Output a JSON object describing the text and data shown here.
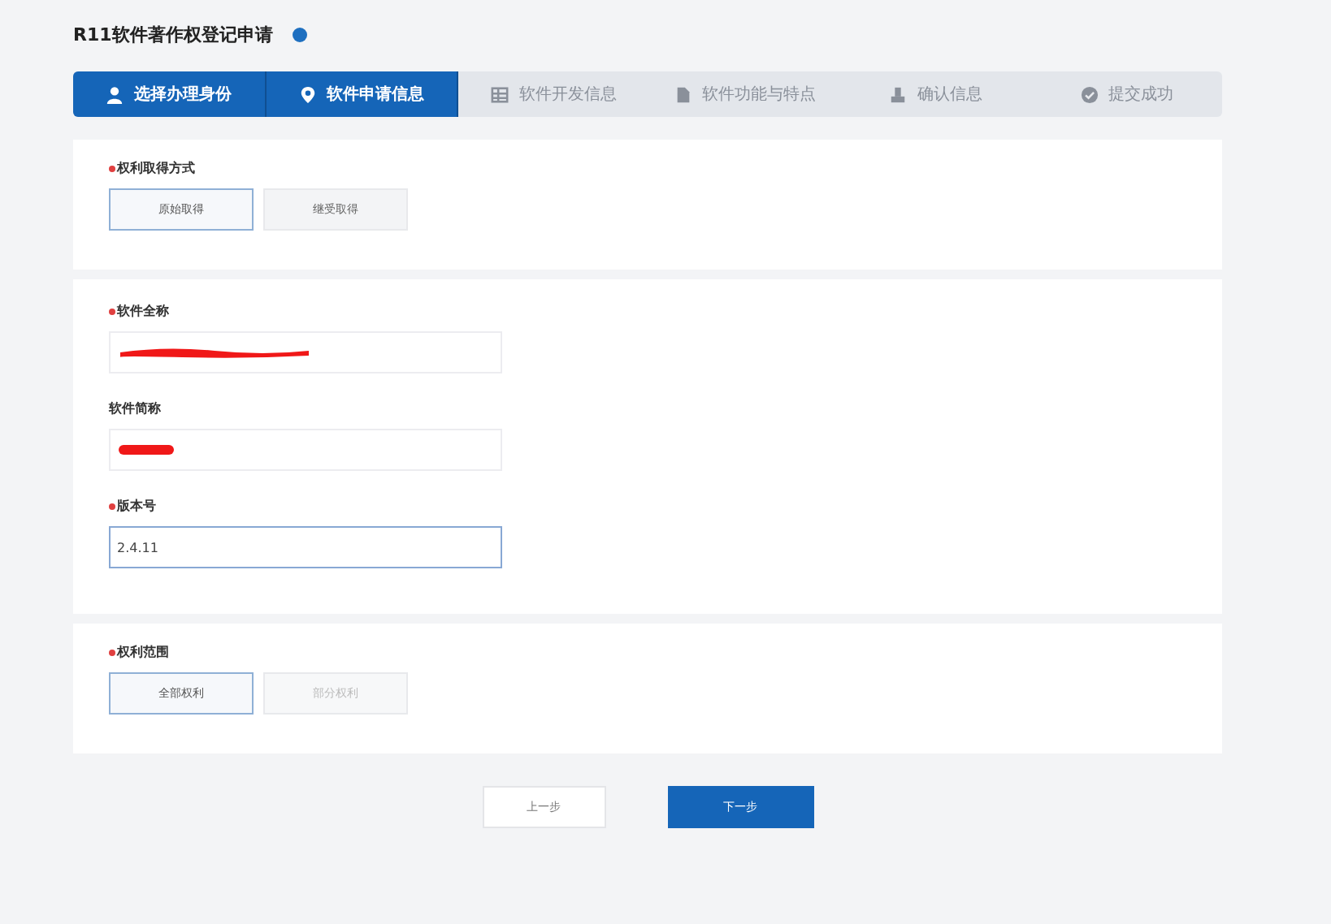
{
  "title": "R11软件著作权登记申请",
  "steps": [
    {
      "label": "选择办理身份",
      "kind": "person",
      "done": true
    },
    {
      "label": "软件申请信息",
      "kind": "pin",
      "done": true
    },
    {
      "label": "软件开发信息",
      "kind": "grid",
      "done": false
    },
    {
      "label": "软件功能与特点",
      "kind": "doc",
      "done": false
    },
    {
      "label": "确认信息",
      "kind": "stamp",
      "done": false
    },
    {
      "label": "提交成功",
      "kind": "check",
      "done": false
    }
  ],
  "sections": [
    {
      "kind": "options",
      "label": "权利取得方式",
      "required": true,
      "options": [
        {
          "label": "原始取得",
          "selected": true,
          "disabled": false
        },
        {
          "label": "继受取得",
          "selected": false,
          "disabled": false
        }
      ]
    },
    {
      "kind": "fields",
      "fields": [
        {
          "label": "软件全称",
          "required": true,
          "redacted": true,
          "focused": false
        },
        {
          "label": "软件简称",
          "required": false,
          "redacted": true,
          "focused": false
        },
        {
          "label": "版本号",
          "required": true,
          "value": "2.4.11",
          "focused": true
        }
      ]
    },
    {
      "kind": "options",
      "label": "权利范围",
      "required": true,
      "options": [
        {
          "label": "全部权利",
          "selected": true,
          "disabled": false
        },
        {
          "label": "部分权利",
          "selected": false,
          "disabled": true
        }
      ]
    }
  ],
  "buttons": [
    {
      "label": "上一步",
      "kind": "secondary"
    },
    {
      "label": "下一步",
      "kind": "primary"
    }
  ]
}
